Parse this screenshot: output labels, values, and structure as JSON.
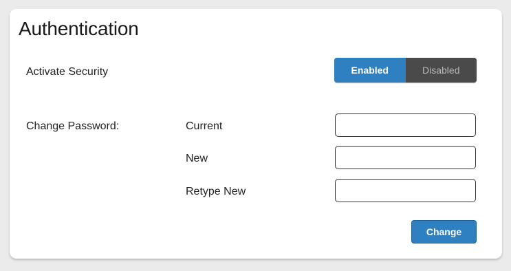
{
  "panel": {
    "title": "Authentication"
  },
  "security": {
    "label": "Activate Security",
    "enabled_label": "Enabled",
    "disabled_label": "Disabled",
    "selected": "Enabled"
  },
  "password": {
    "section_label": "Change Password:",
    "current_label": "Current",
    "current_value": "",
    "new_label": "New",
    "new_value": "",
    "retype_label": "Retype New",
    "retype_value": "",
    "change_button": "Change"
  },
  "colors": {
    "accent": "#2f80c0",
    "toggle_off": "#4a4a4a",
    "background": "#ebebeb",
    "card": "#ffffff"
  }
}
